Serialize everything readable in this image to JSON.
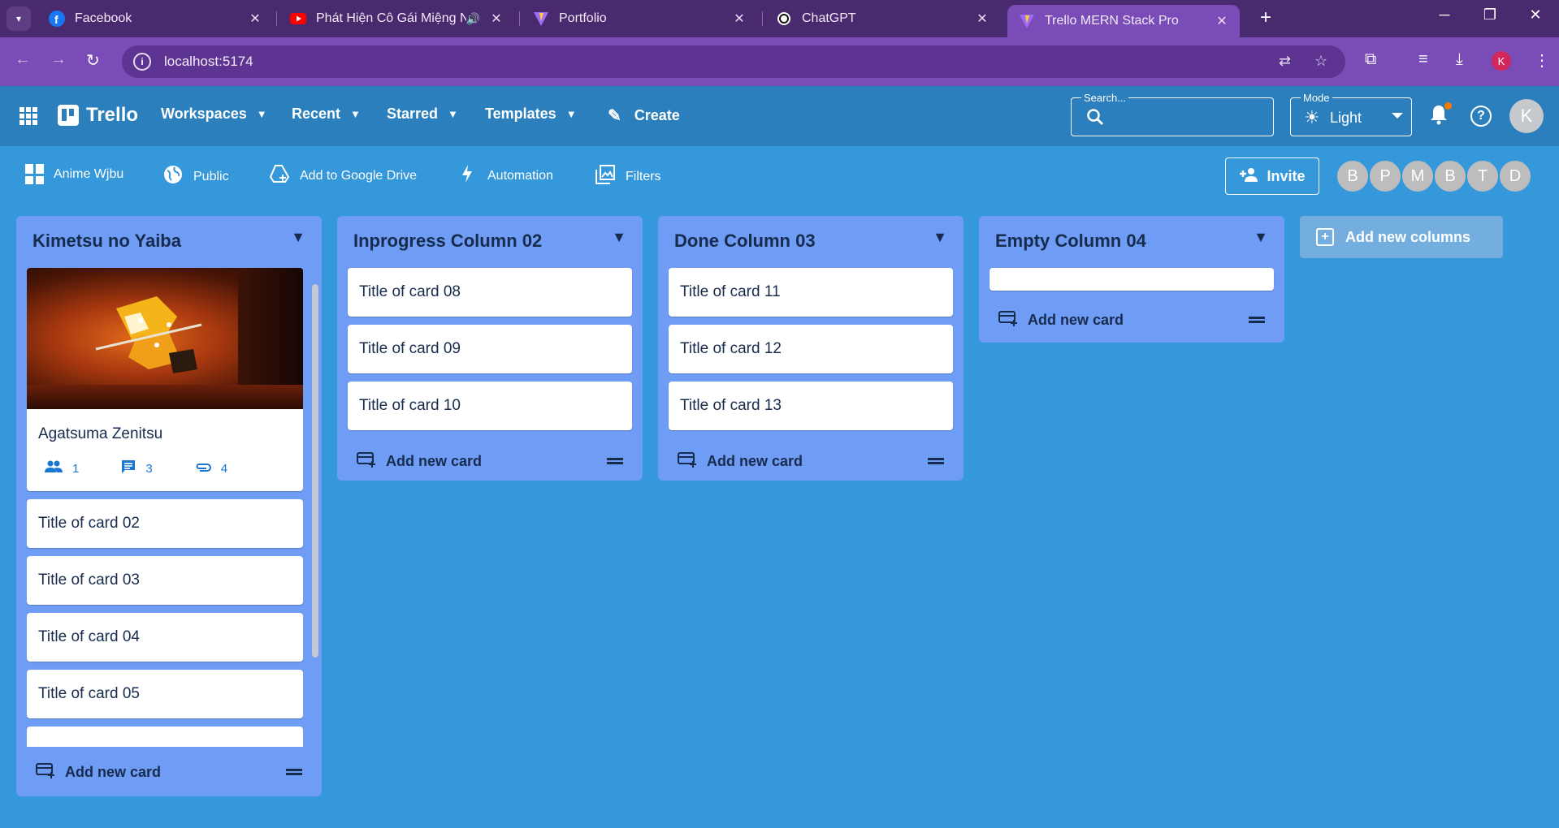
{
  "browser": {
    "tabs": [
      {
        "title": "Facebook",
        "close": "✕"
      },
      {
        "title": "Phát Hiện Cô Gái Miệng Nh",
        "close": "✕"
      },
      {
        "title": "Portfolio",
        "close": "✕"
      },
      {
        "title": "ChatGPT",
        "close": "✕"
      },
      {
        "title": "Trello MERN Stack Pro",
        "close": "✕"
      }
    ],
    "url": "localhost:5174",
    "profile_initial": "K"
  },
  "header": {
    "brand": "Trello",
    "menus": [
      "Workspaces",
      "Recent",
      "Starred",
      "Templates"
    ],
    "create": "Create",
    "search_label": "Search...",
    "mode_label": "Mode",
    "mode_value": "Light",
    "user_initial": "K"
  },
  "boardbar": {
    "board_name": "Anime Wjbu",
    "visibility": "Public",
    "drive": "Add to Google Drive",
    "automation": "Automation",
    "filters": "Filters",
    "invite": "Invite",
    "members": [
      "B",
      "P",
      "M",
      "B",
      "T",
      "D"
    ]
  },
  "columns": [
    {
      "title": "Kimetsu no Yaiba",
      "cover_card": {
        "title": "Agatsuma Zenitsu",
        "members": "1",
        "comments": "3",
        "attachments": "4"
      },
      "cards": [
        "Title of card 02",
        "Title of card 03",
        "Title of card 04",
        "Title of card 05"
      ],
      "add_label": "Add new card"
    },
    {
      "title": "Inprogress Column 02",
      "cards": [
        "Title of card 08",
        "Title of card 09",
        "Title of card 10"
      ],
      "add_label": "Add new card"
    },
    {
      "title": "Done Column 03",
      "cards": [
        "Title of card 11",
        "Title of card 12",
        "Title of card 13"
      ],
      "add_label": "Add new card"
    },
    {
      "title": "Empty Column 04",
      "cards": [],
      "add_label": "Add new card"
    }
  ],
  "add_column_label": "Add new columns",
  "colors": {
    "board_bg": "#3498db",
    "appbar": "#2b7fbc",
    "column_bg": "#6f9cf5",
    "stat_blue": "#1976d2"
  }
}
